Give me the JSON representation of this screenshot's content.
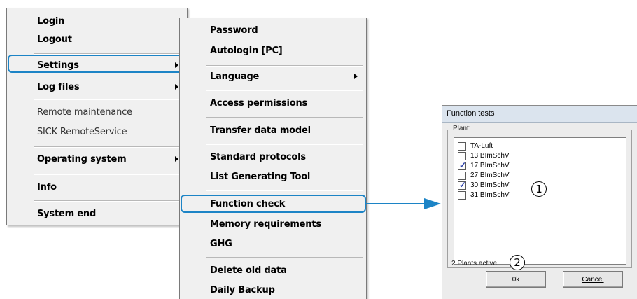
{
  "colors": {
    "highlight": "#1c84c6",
    "arrow": "#1c84c6",
    "check": "#2b3fa8"
  },
  "main_menu": {
    "items": [
      {
        "label": "Login",
        "style": "bold"
      },
      {
        "label": "Logout",
        "style": "bold"
      },
      {
        "label": "Settings",
        "style": "bold",
        "submenu": true,
        "highlighted": true
      },
      {
        "label": "Log files",
        "style": "bold",
        "submenu": true
      },
      {
        "label": "Remote maintenance",
        "style": "normal"
      },
      {
        "label": "SICK RemoteService",
        "style": "normal"
      },
      {
        "label": "Operating system",
        "style": "bold",
        "submenu": true
      },
      {
        "label": "Info",
        "style": "bold"
      },
      {
        "label": "System end",
        "style": "bold"
      }
    ]
  },
  "settings_menu": {
    "items": [
      {
        "label": "Password"
      },
      {
        "label": "Autologin [PC]"
      },
      {
        "label": "Language",
        "submenu": true
      },
      {
        "label": "Access permissions"
      },
      {
        "label": "Transfer data model"
      },
      {
        "label": "Standard protocols"
      },
      {
        "label": "List Generating Tool"
      },
      {
        "label": "Function check",
        "highlighted": true
      },
      {
        "label": "Memory requirements"
      },
      {
        "label": "GHG"
      },
      {
        "label": "Delete old data"
      },
      {
        "label": "Daily Backup"
      }
    ]
  },
  "dialog": {
    "title": "Function tests",
    "group_label": "Plant:",
    "plants": [
      {
        "label": "TA-Luft",
        "checked": false
      },
      {
        "label": "13.BImSchV",
        "checked": false
      },
      {
        "label": "17.BImSchV",
        "checked": true
      },
      {
        "label": "27.BImSchV",
        "checked": false
      },
      {
        "label": "30.BImSchV",
        "checked": true
      },
      {
        "label": "31.BImSchV",
        "checked": false
      }
    ],
    "status": "2 Plants active",
    "ok_label": "0k",
    "cancel_label": "Cancel"
  },
  "callouts": [
    "1",
    "2"
  ]
}
